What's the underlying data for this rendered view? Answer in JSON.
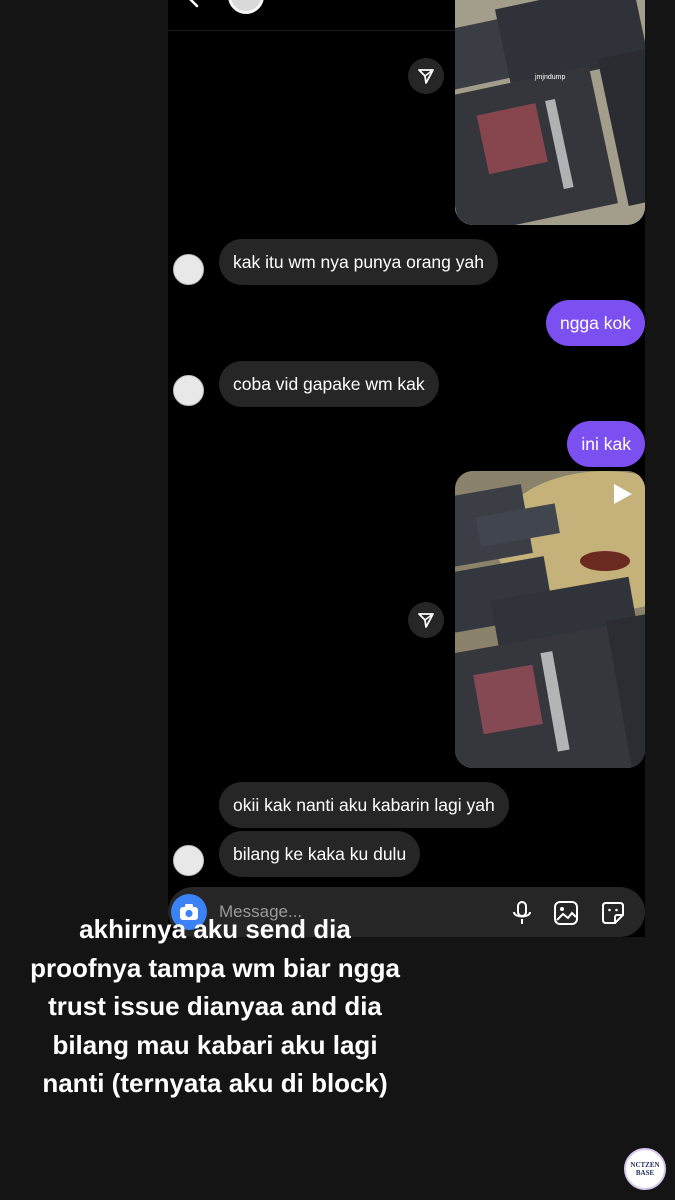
{
  "chat": {
    "messages": [
      {
        "side": "in",
        "text": "kak itu wm nya punya orang yah"
      },
      {
        "side": "out",
        "text": "ngga kok"
      },
      {
        "side": "in",
        "text": "coba vid gapake wm kak"
      },
      {
        "side": "out",
        "text": "ini kak"
      },
      {
        "side": "in",
        "text": "okii kak nanti aku kabarin lagi yah"
      },
      {
        "side": "in",
        "text": "bilang ke kaka ku dulu"
      }
    ],
    "media_watermark": "jmjndump"
  },
  "composer": {
    "placeholder": "Message..."
  },
  "caption": {
    "text": "akhirnya aku send dia proofnya tampa wm biar ngga trust issue dianyaa and dia bilang mau kabari aku lagi nanti (ternyata aku di block)"
  },
  "watermark_logo": {
    "line1": "NCTZEN",
    "line2": "BASE"
  },
  "colors": {
    "outgoing_bubble": "#7b4ff0",
    "incoming_bubble": "#262626",
    "camera_button": "#3b82f6"
  }
}
